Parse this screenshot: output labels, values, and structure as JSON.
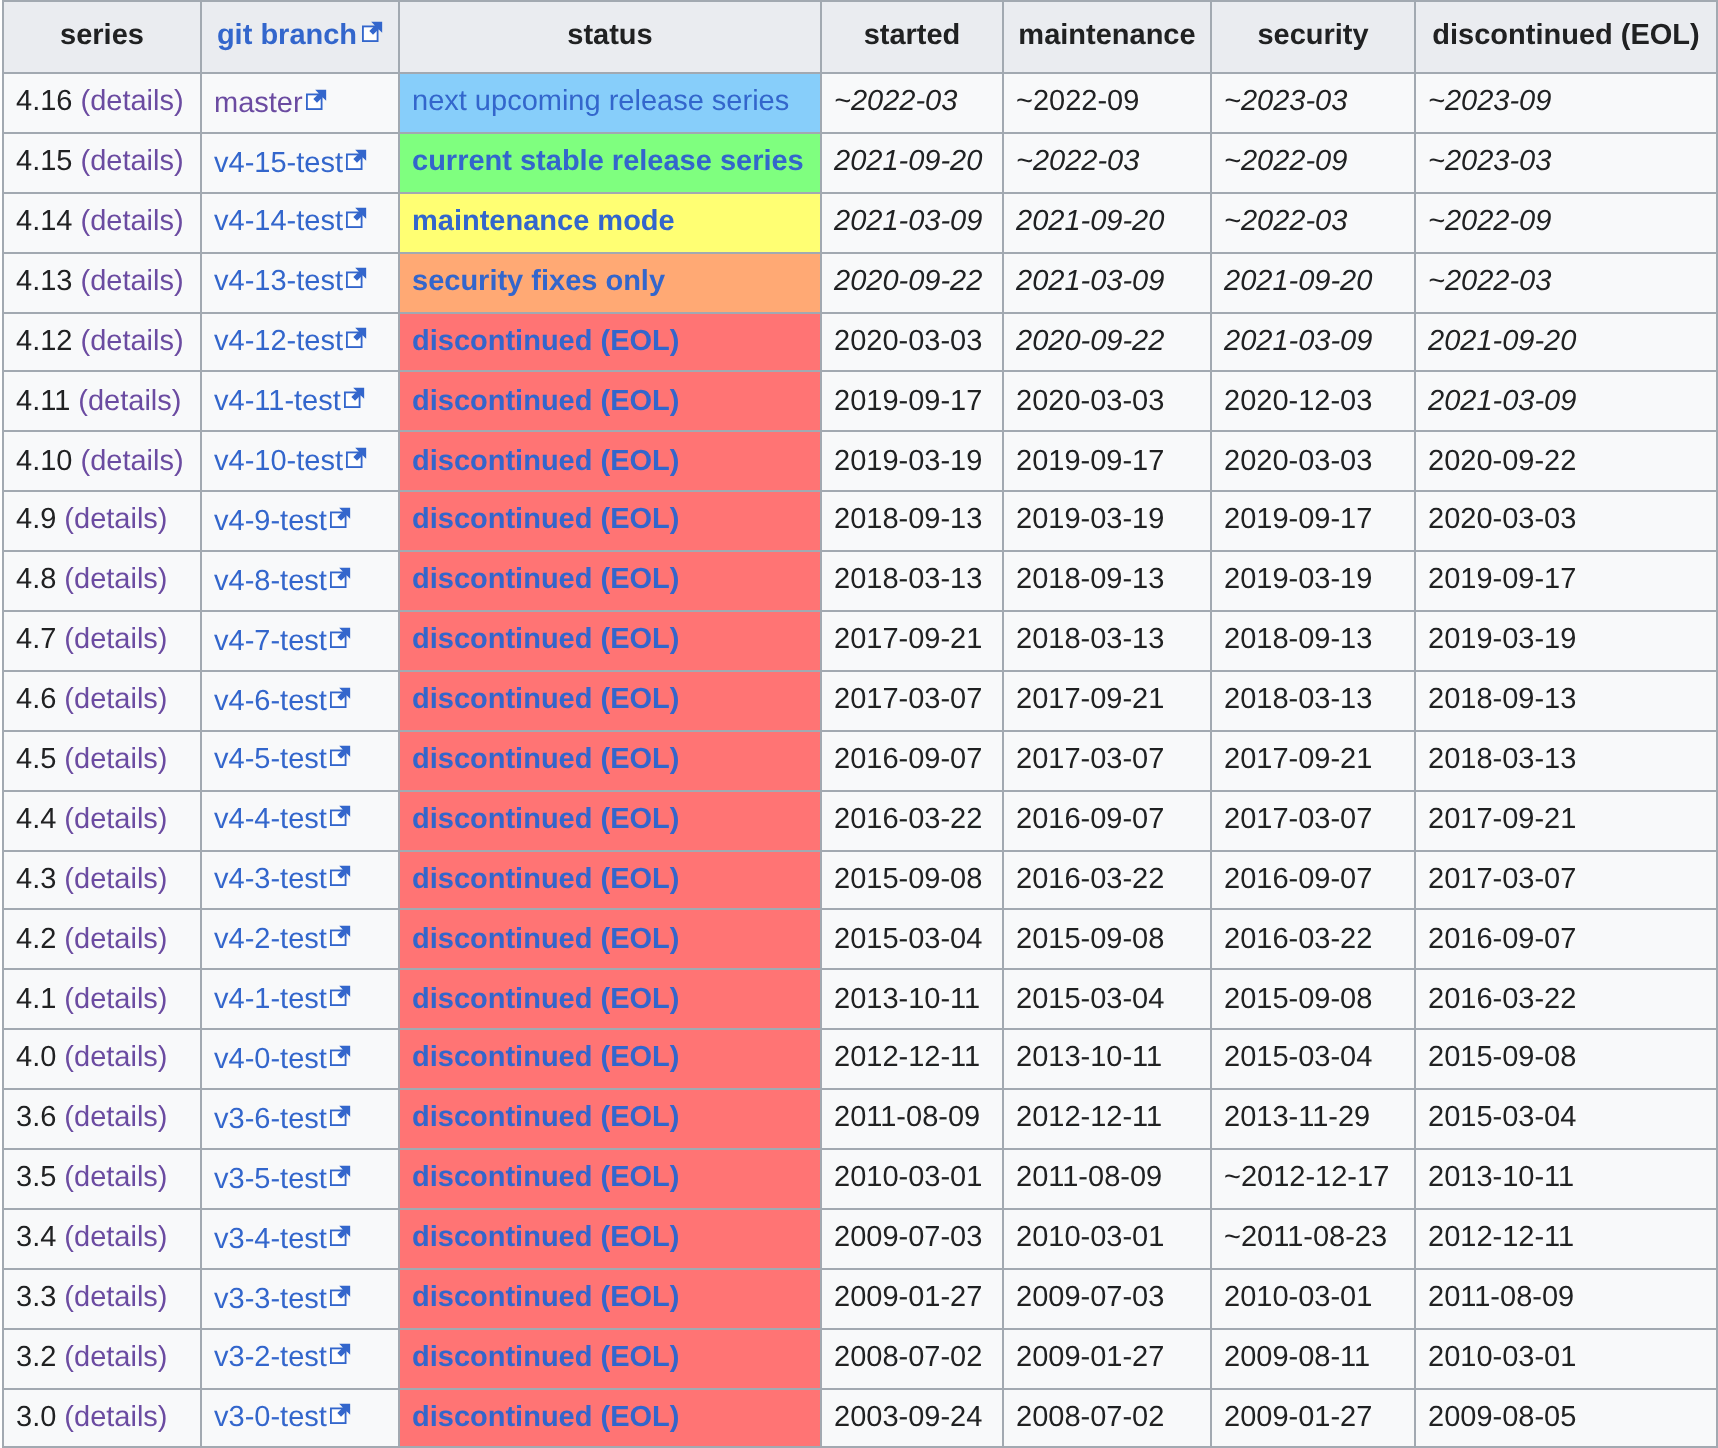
{
  "table": {
    "columns": [
      {
        "label": "series",
        "link": false
      },
      {
        "label": "git branch",
        "link": true
      },
      {
        "label": "status",
        "link": false
      },
      {
        "label": "started",
        "link": false
      },
      {
        "label": "maintenance",
        "link": false
      },
      {
        "label": "security",
        "link": false
      },
      {
        "label": "discontinued (EOL)",
        "link": false
      }
    ],
    "rows": [
      {
        "series": "4.16",
        "details": "(details)",
        "branch": {
          "text": "master",
          "visited": true
        },
        "status": {
          "text": "next upcoming release series",
          "kind": "upcoming",
          "color": "#87cefa"
        },
        "dates": [
          {
            "text": "~2022-03",
            "italic": true
          },
          {
            "text": "~2022-09",
            "italic": false
          },
          {
            "text": "~2023-03",
            "italic": true
          },
          {
            "text": "~2023-09",
            "italic": true
          }
        ]
      },
      {
        "series": "4.15",
        "details": "(details)",
        "branch": {
          "text": "v4-15-test",
          "visited": false
        },
        "status": {
          "text": "current stable release series",
          "kind": "stable",
          "color": "#7fff7f"
        },
        "dates": [
          {
            "text": "2021-09-20",
            "italic": true
          },
          {
            "text": "~2022-03",
            "italic": true
          },
          {
            "text": "~2022-09",
            "italic": true
          },
          {
            "text": "~2023-03",
            "italic": true
          }
        ]
      },
      {
        "series": "4.14",
        "details": "(details)",
        "branch": {
          "text": "v4-14-test",
          "visited": false
        },
        "status": {
          "text": "maintenance mode",
          "kind": "maintenance",
          "color": "#ffff73"
        },
        "dates": [
          {
            "text": "2021-03-09",
            "italic": true
          },
          {
            "text": "2021-09-20",
            "italic": true
          },
          {
            "text": "~2022-03",
            "italic": true
          },
          {
            "text": "~2022-09",
            "italic": true
          }
        ]
      },
      {
        "series": "4.13",
        "details": "(details)",
        "branch": {
          "text": "v4-13-test",
          "visited": false
        },
        "status": {
          "text": "security fixes only",
          "kind": "security",
          "color": "#ffa974"
        },
        "dates": [
          {
            "text": "2020-09-22",
            "italic": true
          },
          {
            "text": "2021-03-09",
            "italic": true
          },
          {
            "text": "2021-09-20",
            "italic": true
          },
          {
            "text": "~2022-03",
            "italic": true
          }
        ]
      },
      {
        "series": "4.12",
        "details": "(details)",
        "branch": {
          "text": "v4-12-test",
          "visited": false
        },
        "status": {
          "text": "discontinued (EOL)",
          "kind": "eol",
          "color": "#ff7474"
        },
        "dates": [
          {
            "text": "2020-03-03",
            "italic": false
          },
          {
            "text": "2020-09-22",
            "italic": true
          },
          {
            "text": "2021-03-09",
            "italic": true
          },
          {
            "text": "2021-09-20",
            "italic": true
          }
        ]
      },
      {
        "series": "4.11",
        "details": "(details)",
        "branch": {
          "text": "v4-11-test",
          "visited": false
        },
        "status": {
          "text": "discontinued (EOL)",
          "kind": "eol",
          "color": "#ff7474"
        },
        "dates": [
          {
            "text": "2019-09-17",
            "italic": false
          },
          {
            "text": "2020-03-03",
            "italic": false
          },
          {
            "text": "2020-12-03",
            "italic": false
          },
          {
            "text": "2021-03-09",
            "italic": true
          }
        ]
      },
      {
        "series": "4.10",
        "details": "(details)",
        "branch": {
          "text": "v4-10-test",
          "visited": false
        },
        "status": {
          "text": "discontinued (EOL)",
          "kind": "eol",
          "color": "#ff7474"
        },
        "dates": [
          {
            "text": "2019-03-19",
            "italic": false
          },
          {
            "text": "2019-09-17",
            "italic": false
          },
          {
            "text": "2020-03-03",
            "italic": false
          },
          {
            "text": "2020-09-22",
            "italic": false
          }
        ]
      },
      {
        "series": "4.9",
        "details": "(details)",
        "branch": {
          "text": "v4-9-test",
          "visited": false
        },
        "status": {
          "text": "discontinued (EOL)",
          "kind": "eol",
          "color": "#ff7474"
        },
        "dates": [
          {
            "text": "2018-09-13",
            "italic": false
          },
          {
            "text": "2019-03-19",
            "italic": false
          },
          {
            "text": "2019-09-17",
            "italic": false
          },
          {
            "text": "2020-03-03",
            "italic": false
          }
        ]
      },
      {
        "series": "4.8",
        "details": "(details)",
        "branch": {
          "text": "v4-8-test",
          "visited": false
        },
        "status": {
          "text": "discontinued (EOL)",
          "kind": "eol",
          "color": "#ff7474"
        },
        "dates": [
          {
            "text": "2018-03-13",
            "italic": false
          },
          {
            "text": "2018-09-13",
            "italic": false
          },
          {
            "text": "2019-03-19",
            "italic": false
          },
          {
            "text": "2019-09-17",
            "italic": false
          }
        ]
      },
      {
        "series": "4.7",
        "details": "(details)",
        "branch": {
          "text": "v4-7-test",
          "visited": false
        },
        "status": {
          "text": "discontinued (EOL)",
          "kind": "eol",
          "color": "#ff7474"
        },
        "dates": [
          {
            "text": "2017-09-21",
            "italic": false
          },
          {
            "text": "2018-03-13",
            "italic": false
          },
          {
            "text": "2018-09-13",
            "italic": false
          },
          {
            "text": "2019-03-19",
            "italic": false
          }
        ]
      },
      {
        "series": "4.6",
        "details": "(details)",
        "branch": {
          "text": "v4-6-test",
          "visited": false
        },
        "status": {
          "text": "discontinued (EOL)",
          "kind": "eol",
          "color": "#ff7474"
        },
        "dates": [
          {
            "text": "2017-03-07",
            "italic": false
          },
          {
            "text": "2017-09-21",
            "italic": false
          },
          {
            "text": "2018-03-13",
            "italic": false
          },
          {
            "text": "2018-09-13",
            "italic": false
          }
        ]
      },
      {
        "series": "4.5",
        "details": "(details)",
        "branch": {
          "text": "v4-5-test",
          "visited": false
        },
        "status": {
          "text": "discontinued (EOL)",
          "kind": "eol",
          "color": "#ff7474"
        },
        "dates": [
          {
            "text": "2016-09-07",
            "italic": false
          },
          {
            "text": "2017-03-07",
            "italic": false
          },
          {
            "text": "2017-09-21",
            "italic": false
          },
          {
            "text": "2018-03-13",
            "italic": false
          }
        ]
      },
      {
        "series": "4.4",
        "details": "(details)",
        "branch": {
          "text": "v4-4-test",
          "visited": false
        },
        "status": {
          "text": "discontinued (EOL)",
          "kind": "eol",
          "color": "#ff7474"
        },
        "dates": [
          {
            "text": "2016-03-22",
            "italic": false
          },
          {
            "text": "2016-09-07",
            "italic": false
          },
          {
            "text": "2017-03-07",
            "italic": false
          },
          {
            "text": "2017-09-21",
            "italic": false
          }
        ]
      },
      {
        "series": "4.3",
        "details": "(details)",
        "branch": {
          "text": "v4-3-test",
          "visited": false
        },
        "status": {
          "text": "discontinued (EOL)",
          "kind": "eol",
          "color": "#ff7474"
        },
        "dates": [
          {
            "text": "2015-09-08",
            "italic": false
          },
          {
            "text": "2016-03-22",
            "italic": false
          },
          {
            "text": "2016-09-07",
            "italic": false
          },
          {
            "text": "2017-03-07",
            "italic": false
          }
        ]
      },
      {
        "series": "4.2",
        "details": "(details)",
        "branch": {
          "text": "v4-2-test",
          "visited": false
        },
        "status": {
          "text": "discontinued (EOL)",
          "kind": "eol",
          "color": "#ff7474"
        },
        "dates": [
          {
            "text": "2015-03-04",
            "italic": false
          },
          {
            "text": "2015-09-08",
            "italic": false
          },
          {
            "text": "2016-03-22",
            "italic": false
          },
          {
            "text": "2016-09-07",
            "italic": false
          }
        ]
      },
      {
        "series": "4.1",
        "details": "(details)",
        "branch": {
          "text": "v4-1-test",
          "visited": false
        },
        "status": {
          "text": "discontinued (EOL)",
          "kind": "eol",
          "color": "#ff7474"
        },
        "dates": [
          {
            "text": "2013-10-11",
            "italic": false
          },
          {
            "text": "2015-03-04",
            "italic": false
          },
          {
            "text": "2015-09-08",
            "italic": false
          },
          {
            "text": "2016-03-22",
            "italic": false
          }
        ]
      },
      {
        "series": "4.0",
        "details": "(details)",
        "branch": {
          "text": "v4-0-test",
          "visited": false
        },
        "status": {
          "text": "discontinued (EOL)",
          "kind": "eol",
          "color": "#ff7474"
        },
        "dates": [
          {
            "text": "2012-12-11",
            "italic": false
          },
          {
            "text": "2013-10-11",
            "italic": false
          },
          {
            "text": "2015-03-04",
            "italic": false
          },
          {
            "text": "2015-09-08",
            "italic": false
          }
        ]
      },
      {
        "series": "3.6",
        "details": "(details)",
        "branch": {
          "text": "v3-6-test",
          "visited": false
        },
        "status": {
          "text": "discontinued (EOL)",
          "kind": "eol",
          "color": "#ff7474"
        },
        "dates": [
          {
            "text": "2011-08-09",
            "italic": false
          },
          {
            "text": "2012-12-11",
            "italic": false
          },
          {
            "text": "2013-11-29",
            "italic": false
          },
          {
            "text": "2015-03-04",
            "italic": false
          }
        ]
      },
      {
        "series": "3.5",
        "details": "(details)",
        "branch": {
          "text": "v3-5-test",
          "visited": false
        },
        "status": {
          "text": "discontinued (EOL)",
          "kind": "eol",
          "color": "#ff7474"
        },
        "dates": [
          {
            "text": "2010-03-01",
            "italic": false
          },
          {
            "text": "2011-08-09",
            "italic": false
          },
          {
            "text": "~2012-12-17",
            "italic": false
          },
          {
            "text": "2013-10-11",
            "italic": false
          }
        ]
      },
      {
        "series": "3.4",
        "details": "(details)",
        "branch": {
          "text": "v3-4-test",
          "visited": false
        },
        "status": {
          "text": "discontinued (EOL)",
          "kind": "eol",
          "color": "#ff7474"
        },
        "dates": [
          {
            "text": "2009-07-03",
            "italic": false
          },
          {
            "text": "2010-03-01",
            "italic": false
          },
          {
            "text": "~2011-08-23",
            "italic": false
          },
          {
            "text": "2012-12-11",
            "italic": false
          }
        ]
      },
      {
        "series": "3.3",
        "details": "(details)",
        "branch": {
          "text": "v3-3-test",
          "visited": false
        },
        "status": {
          "text": "discontinued (EOL)",
          "kind": "eol",
          "color": "#ff7474"
        },
        "dates": [
          {
            "text": "2009-01-27",
            "italic": false
          },
          {
            "text": "2009-07-03",
            "italic": false
          },
          {
            "text": "2010-03-01",
            "italic": false
          },
          {
            "text": "2011-08-09",
            "italic": false
          }
        ]
      },
      {
        "series": "3.2",
        "details": "(details)",
        "branch": {
          "text": "v3-2-test",
          "visited": false
        },
        "status": {
          "text": "discontinued (EOL)",
          "kind": "eol",
          "color": "#ff7474"
        },
        "dates": [
          {
            "text": "2008-07-02",
            "italic": false
          },
          {
            "text": "2009-01-27",
            "italic": false
          },
          {
            "text": "2009-08-11",
            "italic": false
          },
          {
            "text": "2010-03-01",
            "italic": false
          }
        ]
      },
      {
        "series": "3.0",
        "details": "(details)",
        "branch": {
          "text": "v3-0-test",
          "visited": false
        },
        "status": {
          "text": "discontinued (EOL)",
          "kind": "eol",
          "color": "#ff7474"
        },
        "dates": [
          {
            "text": "2003-09-24",
            "italic": false
          },
          {
            "text": "2008-07-02",
            "italic": false
          },
          {
            "text": "2009-01-27",
            "italic": false
          },
          {
            "text": "2009-08-05",
            "italic": false
          }
        ]
      }
    ]
  }
}
